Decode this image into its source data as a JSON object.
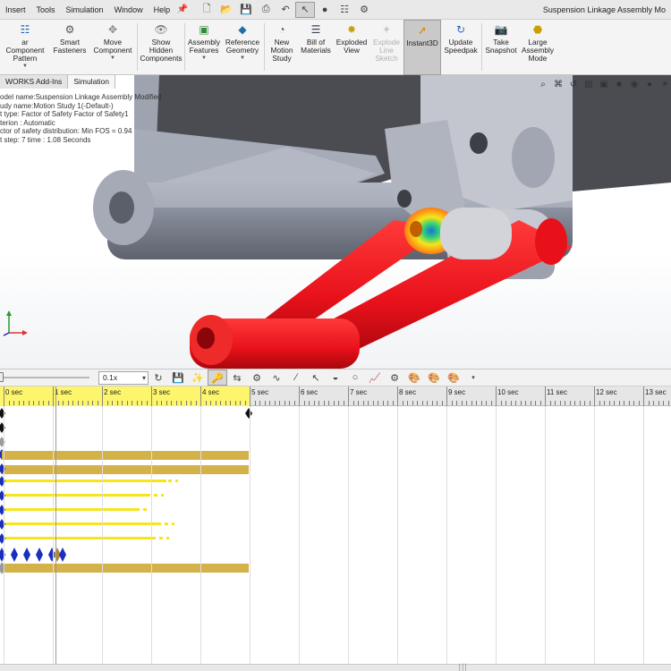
{
  "menu": [
    "Insert",
    "Tools",
    "Simulation",
    "Window",
    "Help"
  ],
  "window_title": "Suspension Linkage Assembly Mo",
  "ribbon": [
    {
      "label": "ar Component Pattern",
      "icon": "pattern-icon"
    },
    {
      "label": "Smart Fasteners",
      "icon": "fastener-icon"
    },
    {
      "label": "Move Component",
      "icon": "move-icon"
    },
    {
      "label": "Show Hidden Components",
      "icon": "show-hidden-icon"
    },
    {
      "label": "Assembly Features",
      "icon": "assembly-features-icon"
    },
    {
      "label": "Reference Geometry",
      "icon": "reference-geometry-icon"
    },
    {
      "label": "New Motion Study",
      "icon": "motion-study-icon"
    },
    {
      "label": "Bill of Materials",
      "icon": "bom-icon"
    },
    {
      "label": "Exploded View",
      "icon": "exploded-view-icon"
    },
    {
      "label": "Explode Line Sketch",
      "icon": "explode-line-icon"
    },
    {
      "label": "Instant3D",
      "icon": "instant3d-icon"
    },
    {
      "label": "Update Speedpak",
      "icon": "speedpak-icon"
    },
    {
      "label": "Take Snapshot",
      "icon": "snapshot-icon"
    },
    {
      "label": "Large Assembly Mode",
      "icon": "large-assembly-icon"
    }
  ],
  "tabs": [
    "WORKS Add-Ins",
    "Simulation"
  ],
  "info_lines": [
    "odel name:Suspension Linkage Assembly Modified",
    "udy name:Motion Study 1(-Default-)",
    "t type: Factor of Safety Factor of Safety1",
    "terion : Automatic",
    "ctor of safety distribution: Min FOS = 0.94",
    "t step: 7   time : 1.08 Seconds"
  ],
  "timeline": {
    "speed": "0.1x",
    "time_labels": [
      "0 sec",
      "1 sec",
      "2 sec",
      "3 sec",
      "4 sec",
      "5 sec",
      "6 sec",
      "7 sec",
      "8 sec",
      "9 sec",
      "10 sec",
      "11 sec",
      "12 sec",
      "13 sec"
    ],
    "key_color": "#1a2fbf",
    "bar_color": "#d4b24a",
    "highlight_color": "#fdf56b"
  },
  "colors": {
    "link_red": "#e8111a",
    "body_gray": "#9ea3b0",
    "dark_gray": "#4a4c52"
  }
}
